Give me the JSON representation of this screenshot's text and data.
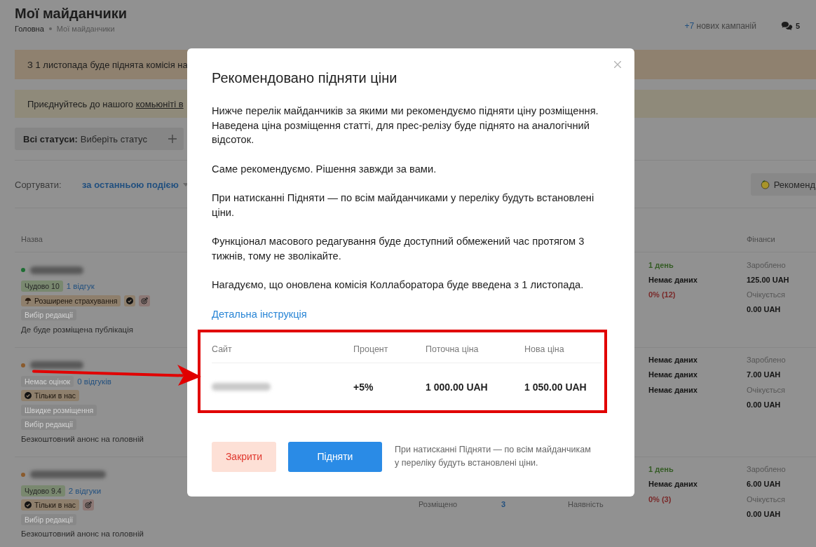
{
  "page": {
    "title": "Мої майданчики",
    "breadcrumbs": [
      {
        "label": "Головна",
        "current": false
      },
      {
        "label": "Мої майданчики",
        "current": true
      }
    ]
  },
  "header": {
    "campaigns": {
      "count": "+7",
      "label": "нових кампаній"
    },
    "messages": "5"
  },
  "banners": [
    {
      "kind": "warning",
      "text": "З 1 листопада буде піднята комісія на"
    },
    {
      "kind": "info",
      "text": "Приєднуйтесь до нашого",
      "link": "комьюніті в"
    }
  ],
  "filter": {
    "label": "Всі статуси:",
    "value": "Виберіть статус"
  },
  "sort": {
    "label": "Сортувати:",
    "value": "за останньою подією"
  },
  "recommend_button": "Рекоменд",
  "table": {
    "columns": [
      {
        "kind": "name",
        "label": "Назва"
      },
      {
        "kind": "finance",
        "label": "Фінанси"
      }
    ],
    "rows": [
      {
        "color": "#1e6d33",
        "rating": {
          "kind": "good",
          "text": "Чудово 10"
        },
        "reviews": "1 відгук",
        "tag_lines": [
          [
            {
              "kind": "insurance",
              "text": "Розширене страхування"
            },
            {
              "kind": "exclusive"
            },
            {
              "kind": "target"
            }
          ],
          [
            {
              "kind": "muted",
              "text": "Вибір редакції"
            }
          ]
        ],
        "note": "Де буде розміщена публікація",
        "timing": [
          {
            "kind": "positive",
            "text": "1 день"
          },
          {
            "kind": "plain",
            "text": "Немає даних"
          },
          {
            "kind": "negative",
            "text": "0% (12)"
          }
        ],
        "finance": [
          {
            "label": "Зароблено",
            "value": "125.00 UAH"
          },
          {
            "label": "Очікується",
            "value": "0.00 UAH"
          }
        ]
      },
      {
        "color": "#8a5b2d",
        "rating": {
          "kind": "none",
          "text": "Немає оцінок"
        },
        "reviews": "0 відгуків",
        "tag_lines": [
          [
            {
              "kind": "exclusive",
              "text": "Тільки в нас"
            }
          ],
          [
            {
              "kind": "muted",
              "text": "Швидке розміщення"
            }
          ],
          [
            {
              "kind": "muted",
              "text": "Вибір редакції"
            }
          ]
        ],
        "note": "Безкоштовний анонс на головній",
        "timing": [
          {
            "kind": "plain",
            "text": "Немає даних"
          },
          {
            "kind": "plain",
            "text": "Немає даних"
          },
          {
            "kind": "plain",
            "text": "Немає даних"
          }
        ],
        "finance": [
          {
            "label": "Зароблено",
            "value": "7.00 UAH"
          },
          {
            "label": "Очікується",
            "value": "0.00 UAH"
          }
        ]
      },
      {
        "color": "#8a5b2d",
        "rating": {
          "kind": "good",
          "text": "Чудово 9.4"
        },
        "reviews": "2 відгуки",
        "tag_lines": [
          [
            {
              "kind": "exclusive",
              "text": "Тільки в нас"
            },
            {
              "kind": "target"
            }
          ],
          [
            {
              "kind": "muted",
              "text": "Вибір редакції"
            }
          ]
        ],
        "note": "Безкоштовний анонс на головній",
        "placed": {
          "label": "Розміщено",
          "value": "3"
        },
        "availability": "Наявність",
        "timing": [
          {
            "kind": "positive",
            "text": "1 день"
          },
          {
            "kind": "plain",
            "text": "Немає даних"
          },
          {
            "kind": "negative",
            "text": "0% (3)"
          }
        ],
        "finance": [
          {
            "label": "Зароблено",
            "value": "6.00 UAH"
          },
          {
            "label": "Очікується",
            "value": "0.00 UAH"
          }
        ]
      }
    ]
  },
  "modal": {
    "title": "Рекомендовано підняти ціни",
    "paragraphs": [
      "Нижче перелік майданчиків за якими ми рекомендуємо підняти ціну розміщення. Наведена ціна розміщення статті, для прес-релізу буде піднято на аналогічний відсоток.",
      "Саме рекомендуємо. Рішення завжди за вами.",
      "При натисканні Підняти — по всім майданчиками у переліку будуть встановлені ціни.",
      "Функціонал масового редагування буде доступний обмежений час протягом 3 тижнів, тому не зволікайте.",
      "Нагадуємо, що оновлена комісія Коллаборатора буде введена з 1 листопада."
    ],
    "link": "Детальна інструкція",
    "table": {
      "columns": [
        "Сайт",
        "Процент",
        "Поточна ціна",
        "Нова ціна"
      ],
      "rows": [
        {
          "percent": "+5%",
          "current_price": "1 000.00 UAH",
          "new_price": "1 050.00 UAH"
        }
      ]
    },
    "buttons": [
      {
        "kind": "secondary",
        "label": "Закрити"
      },
      {
        "kind": "primary",
        "label": "Підняти"
      }
    ],
    "note": "При натисканні Підняти — по всім майданчикам у переліку будуть встановлені ціни."
  }
}
